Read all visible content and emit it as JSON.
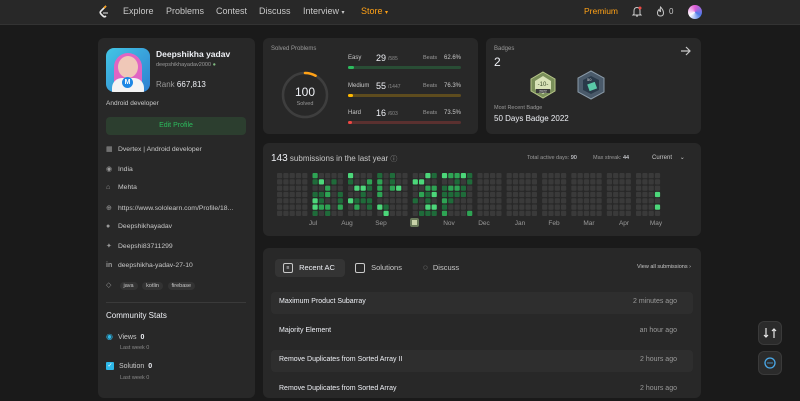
{
  "nav": {
    "items": [
      "Explore",
      "Problems",
      "Contest",
      "Discuss",
      "Interview",
      "Store"
    ],
    "premium": "Premium",
    "streak_count": "0"
  },
  "profile": {
    "name": "Deepshikha yadav",
    "handle": "deepshikhayadav2000",
    "rank_label": "Rank",
    "rank_value": "667,813",
    "bio": "Android developer",
    "edit_label": "Edit Profile",
    "info": [
      {
        "icon": "building-icon",
        "text": "Dvertex | Android developer"
      },
      {
        "icon": "location-icon",
        "text": "India"
      },
      {
        "icon": "school-icon",
        "text": "Mehta"
      },
      {
        "icon": "globe-icon",
        "text": "https://www.sololearn.com/Profile/18..."
      },
      {
        "icon": "github-icon",
        "text": "Deepshikhayadav"
      },
      {
        "icon": "twitter-icon",
        "text": "Deepshi83711299"
      },
      {
        "icon": "linkedin-icon",
        "text": "deepshikha-yadav-27-10"
      }
    ],
    "skills": [
      "java",
      "kotlin",
      "firebase"
    ]
  },
  "community": {
    "title": "Community Stats",
    "stats": [
      {
        "label": "Views",
        "value": "0",
        "sub": "Last week 0"
      },
      {
        "label": "Solution",
        "value": "0",
        "sub": "Last week 0"
      }
    ]
  },
  "solved": {
    "title": "Solved Problems",
    "total": "100",
    "total_label": "Solved",
    "rows": [
      {
        "name": "Easy",
        "count": "29",
        "total": "/585",
        "beats": "Beats",
        "pct": "62.6%",
        "color": "#2cbb5d",
        "fraction": 0.05
      },
      {
        "name": "Medium",
        "count": "55",
        "total": "/1447",
        "beats": "Beats",
        "pct": "76.3%",
        "color": "#ffb800",
        "fraction": 0.04
      },
      {
        "name": "Hard",
        "count": "16",
        "total": "/603",
        "beats": "Beats",
        "pct": "73.5%",
        "color": "#ef4743",
        "fraction": 0.03
      }
    ]
  },
  "badges": {
    "title": "Badges",
    "count": "2",
    "badge1_text": "2022",
    "badge2_text": "50",
    "recent_label": "Most Recent Badge",
    "recent_name": "50 Days Badge 2022"
  },
  "heatmap": {
    "count": "143",
    "title_suffix": "submissions in the last year",
    "active_days_label": "Total active days:",
    "active_days": "90",
    "max_streak_label": "Max streak:",
    "max_streak": "44",
    "range": "Current",
    "months": [
      "Jul",
      "Aug",
      "Sep",
      "Oct",
      "Nov",
      "Dec",
      "Jan",
      "Feb",
      "Mar",
      "Apr",
      "May"
    ]
  },
  "recent": {
    "tabs": [
      "Recent AC",
      "Solutions",
      "Discuss"
    ],
    "view_all": "View all submissions",
    "rows": [
      {
        "title": "Maximum Product Subarray",
        "time": "2 minutes ago"
      },
      {
        "title": "Majority Element",
        "time": "an hour ago"
      },
      {
        "title": "Remove Duplicates from Sorted Array II",
        "time": "2 hours ago"
      },
      {
        "title": "Remove Duplicates from Sorted Array",
        "time": "2 hours ago"
      }
    ]
  }
}
